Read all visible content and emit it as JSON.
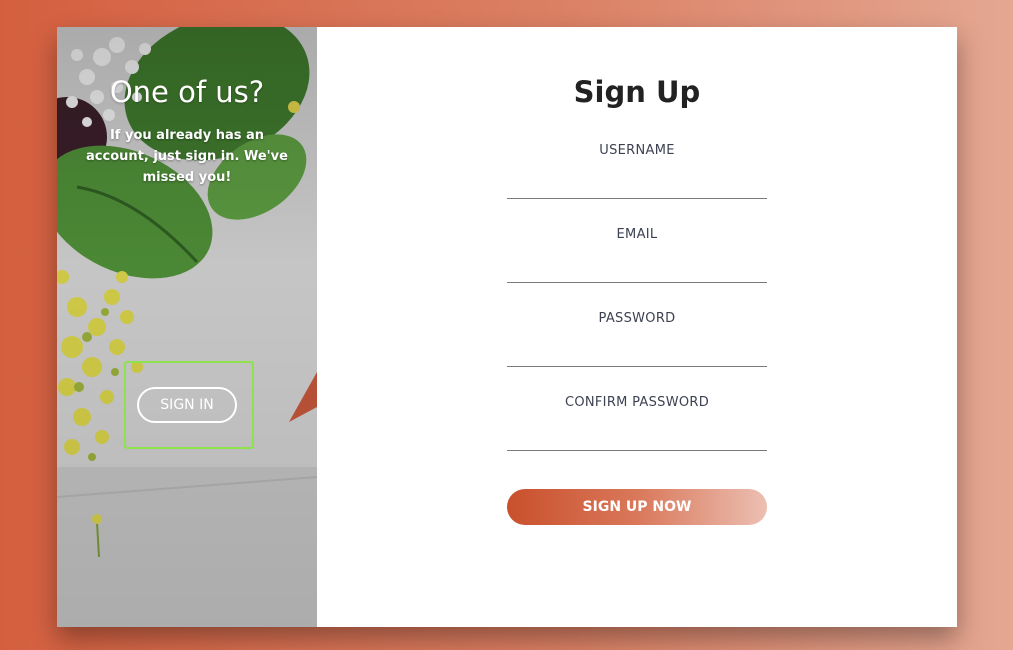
{
  "left_panel": {
    "title": "One of us?",
    "subtitle": "If you already has an account, just sign in. We've missed you!",
    "sign_in_label": "SIGN IN"
  },
  "form": {
    "title": "Sign Up",
    "fields": [
      {
        "label": "USERNAME",
        "value": ""
      },
      {
        "label": "EMAIL",
        "value": ""
      },
      {
        "label": "PASSWORD",
        "value": ""
      },
      {
        "label": "CONFIRM PASSWORD",
        "value": ""
      }
    ],
    "submit_label": "SIGN UP NOW"
  },
  "colors": {
    "background_start": "#d45f3f",
    "background_end": "#e4a792",
    "button_gradient_start": "#c9502c",
    "button_gradient_end": "#ecbfb2",
    "highlight_border": "#8ee24a"
  }
}
